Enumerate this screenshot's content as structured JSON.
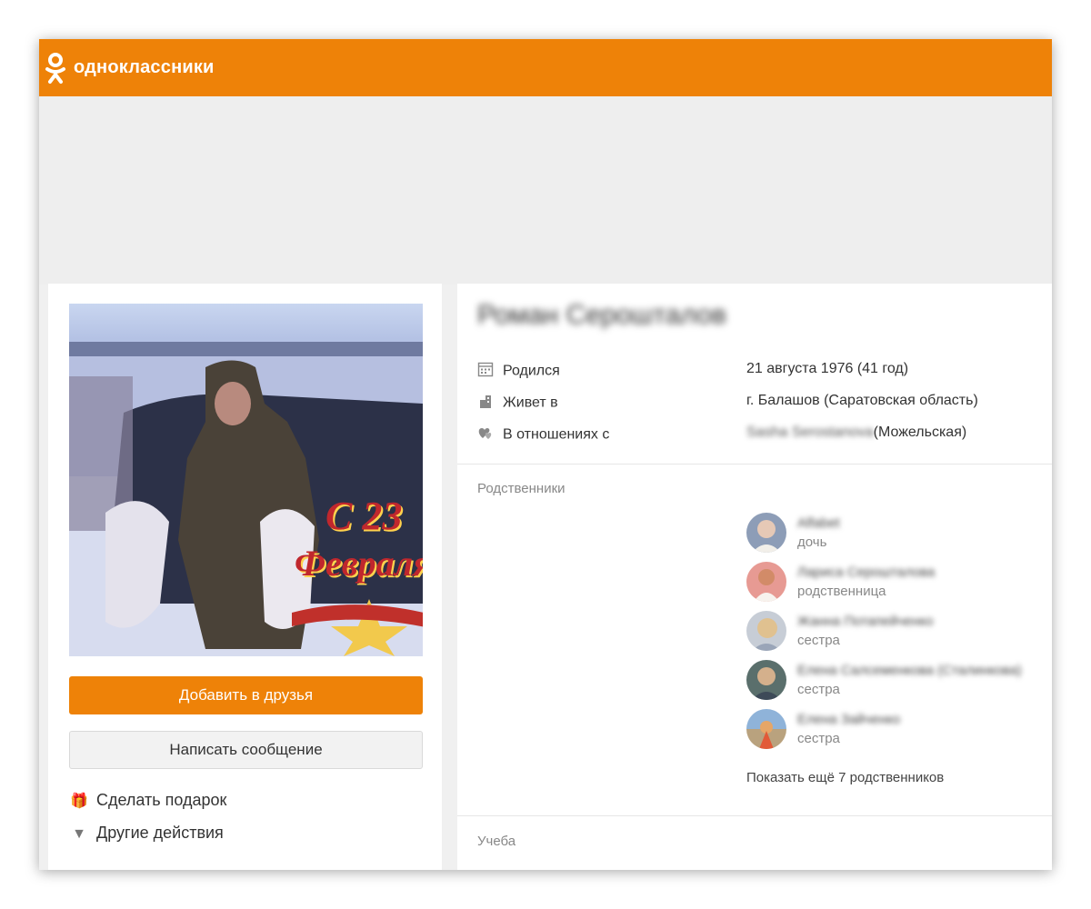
{
  "header": {
    "brand": "одноклассники",
    "brand_color": "#ee8208"
  },
  "profile": {
    "name": "Роман Серошталов",
    "buttons": {
      "add_friend": "Добавить в друзья",
      "send_message": "Написать сообщение"
    },
    "actions": {
      "gift": "Сделать подарок",
      "other": "Другие действия"
    },
    "photo_overlay": {
      "line1": "С 23",
      "line2": "Февраля"
    }
  },
  "info": {
    "born_label": "Родился",
    "born_value": "21 августа 1976 (41 год)",
    "lives_label": "Живет в",
    "lives_value": "г. Балашов (Саратовская область)",
    "relationship_label": "В отношениях с",
    "relationship_name_hidden": "Sasha Serostanova",
    "relationship_name_visible": "(Можельская)"
  },
  "relatives": {
    "title": "Родственники",
    "items": [
      {
        "name": "Alfabet",
        "role": "дочь"
      },
      {
        "name": "Лариса Серошталова",
        "role": "родственница"
      },
      {
        "name": "Жанна Потапейченко",
        "role": "сестра"
      },
      {
        "name": "Елена Салсеменкова (Сталинкова)",
        "role": "сестра"
      },
      {
        "name": "Елена Зайченко",
        "role": "сестра"
      }
    ],
    "more": "Показать ещё 7 родственников"
  },
  "education": {
    "title": "Учеба"
  }
}
